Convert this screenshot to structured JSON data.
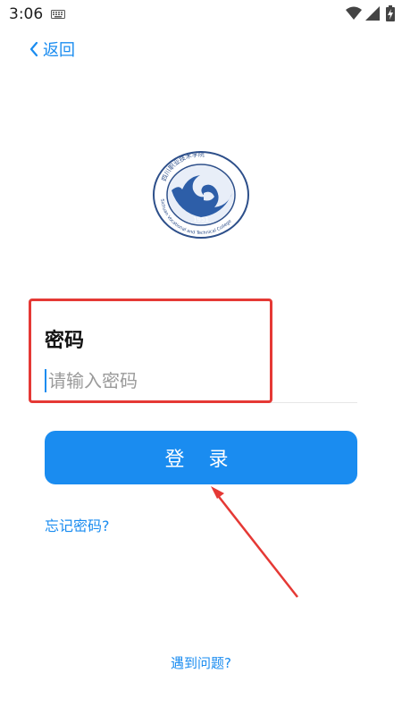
{
  "status_bar": {
    "time": "3:06"
  },
  "nav": {
    "back_label": "返回"
  },
  "logo": {
    "name": "四川职业技术学院",
    "english": "Sichuan Vocational and Technical College",
    "year": "1951"
  },
  "password": {
    "label": "密码",
    "placeholder": "请输入密码",
    "value": ""
  },
  "login_button": {
    "label": "登 录"
  },
  "links": {
    "forgot_password": "忘记密码?",
    "problem": "遇到问题?"
  },
  "colors": {
    "accent": "#1a8cf0",
    "highlight": "#e53935"
  }
}
